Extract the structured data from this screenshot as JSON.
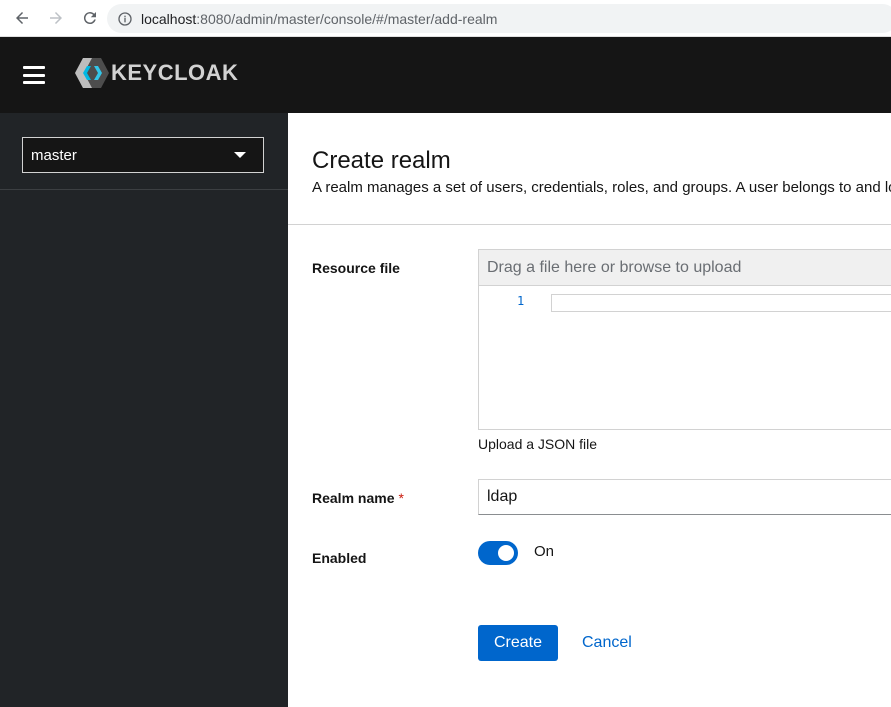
{
  "browser": {
    "url_host": "localhost",
    "url_path": ":8080/admin/master/console/#/master/add-realm"
  },
  "masthead": {
    "brand_text": "KEYCLOAK"
  },
  "sidebar": {
    "realm_selected": "master"
  },
  "page": {
    "title": "Create realm",
    "description": "A realm manages a set of users, credentials, roles, and groups. A user belongs to and logs into a realm."
  },
  "form": {
    "resource_file_label": "Resource file",
    "file_drop_text": "Drag a file here or browse to upload",
    "editor_line_number": "1",
    "helper_text": "Upload a JSON file",
    "realm_name_label": "Realm name",
    "required_marker": "*",
    "realm_name_value": "ldap",
    "enabled_label": "Enabled",
    "enabled_state": "On",
    "create_label": "Create",
    "cancel_label": "Cancel"
  },
  "colors": {
    "accent": "#0066cc",
    "masthead_bg": "#151515",
    "sidebar_bg": "#212427",
    "required": "#c9190b"
  }
}
